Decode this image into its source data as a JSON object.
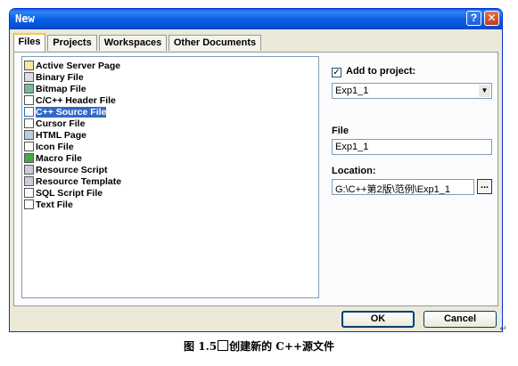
{
  "window": {
    "title": "New",
    "help_label": "?",
    "close_label": "✕"
  },
  "tabs": [
    {
      "label": "Files",
      "active": true
    },
    {
      "label": "Projects",
      "active": false
    },
    {
      "label": "Workspaces",
      "active": false
    },
    {
      "label": "Other Documents",
      "active": false
    }
  ],
  "file_types": [
    {
      "label": "Active Server Page",
      "icon": "asp-page-icon"
    },
    {
      "label": "Binary File",
      "icon": "binary-file-icon"
    },
    {
      "label": "Bitmap File",
      "icon": "bitmap-file-icon"
    },
    {
      "label": "C/C++ Header File",
      "icon": "header-file-icon"
    },
    {
      "label": "C++ Source File",
      "icon": "cpp-source-file-icon",
      "selected": true
    },
    {
      "label": "Cursor File",
      "icon": "cursor-file-icon"
    },
    {
      "label": "HTML Page",
      "icon": "html-page-icon"
    },
    {
      "label": "Icon File",
      "icon": "icon-file-icon"
    },
    {
      "label": "Macro File",
      "icon": "macro-file-icon"
    },
    {
      "label": "Resource Script",
      "icon": "resource-script-icon"
    },
    {
      "label": "Resource Template",
      "icon": "resource-template-icon"
    },
    {
      "label": "SQL Script File",
      "icon": "sql-script-file-icon"
    },
    {
      "label": "Text File",
      "icon": "text-file-icon"
    }
  ],
  "add_to_project": {
    "label": "Add to project:",
    "checked": true,
    "check_mark": "✓",
    "value": "Exp1_1",
    "arrow": "▼"
  },
  "file": {
    "label": "File",
    "value": "Exp1_1"
  },
  "location": {
    "label": "Location:",
    "value": "G:\\C++第2版\\范例\\Exp1_1",
    "browse_label": "..."
  },
  "buttons": {
    "ok": "OK",
    "cancel": "Cancel"
  },
  "caption": {
    "prefix": "图 1.5",
    "suffix": "创建新的 C++源文件"
  },
  "colors": {
    "title_bar": "#0a5fe6",
    "selection": "#316ac5",
    "dialog_bg": "#ece9d8"
  }
}
